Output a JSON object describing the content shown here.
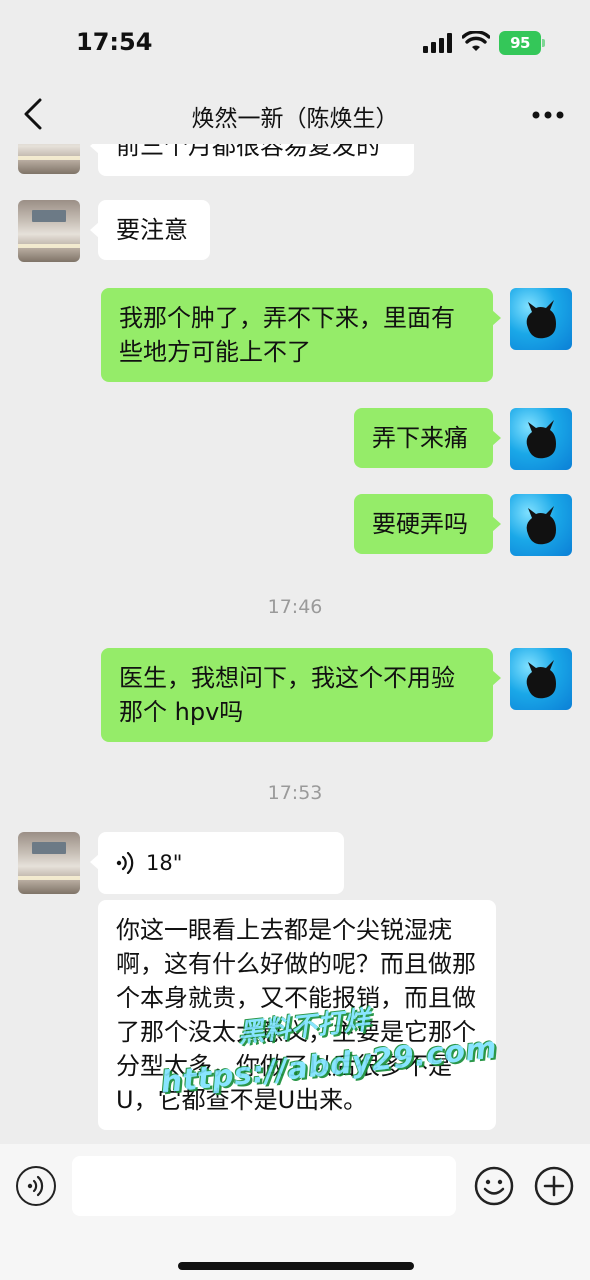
{
  "status_bar": {
    "time": "17:54",
    "battery": "95"
  },
  "header": {
    "title": "焕然一新（陈焕生）"
  },
  "messages": {
    "m0": "前三个月都很容易复发的",
    "m1": "要注意",
    "m2": "我那个肿了，弄不下来，里面有些地方可能上不了",
    "m3": "弄下来痛",
    "m4": "要硬弄吗",
    "t1": "17:46",
    "m5": "医生，我想问下，我这个不用验那个 hpv吗",
    "t2": "17:53",
    "voice_duration": "18\"",
    "m6": "你这一眼看上去都是个尖锐湿疣啊，这有什么好做的呢？而且做那个本身就贵，又不能报销，而且做了那个没太大意义，主要是它那个分型太多，你做了以后很多不是U，它都查不是U出来。"
  },
  "watermark": {
    "line1": "黑料不打烊",
    "line2": "https://abdy29.com"
  },
  "input": {
    "value": ""
  },
  "colors": {
    "green_bubble": "#95ec69",
    "white_bubble": "#ffffff",
    "background": "#ededed",
    "battery": "#34c759"
  }
}
